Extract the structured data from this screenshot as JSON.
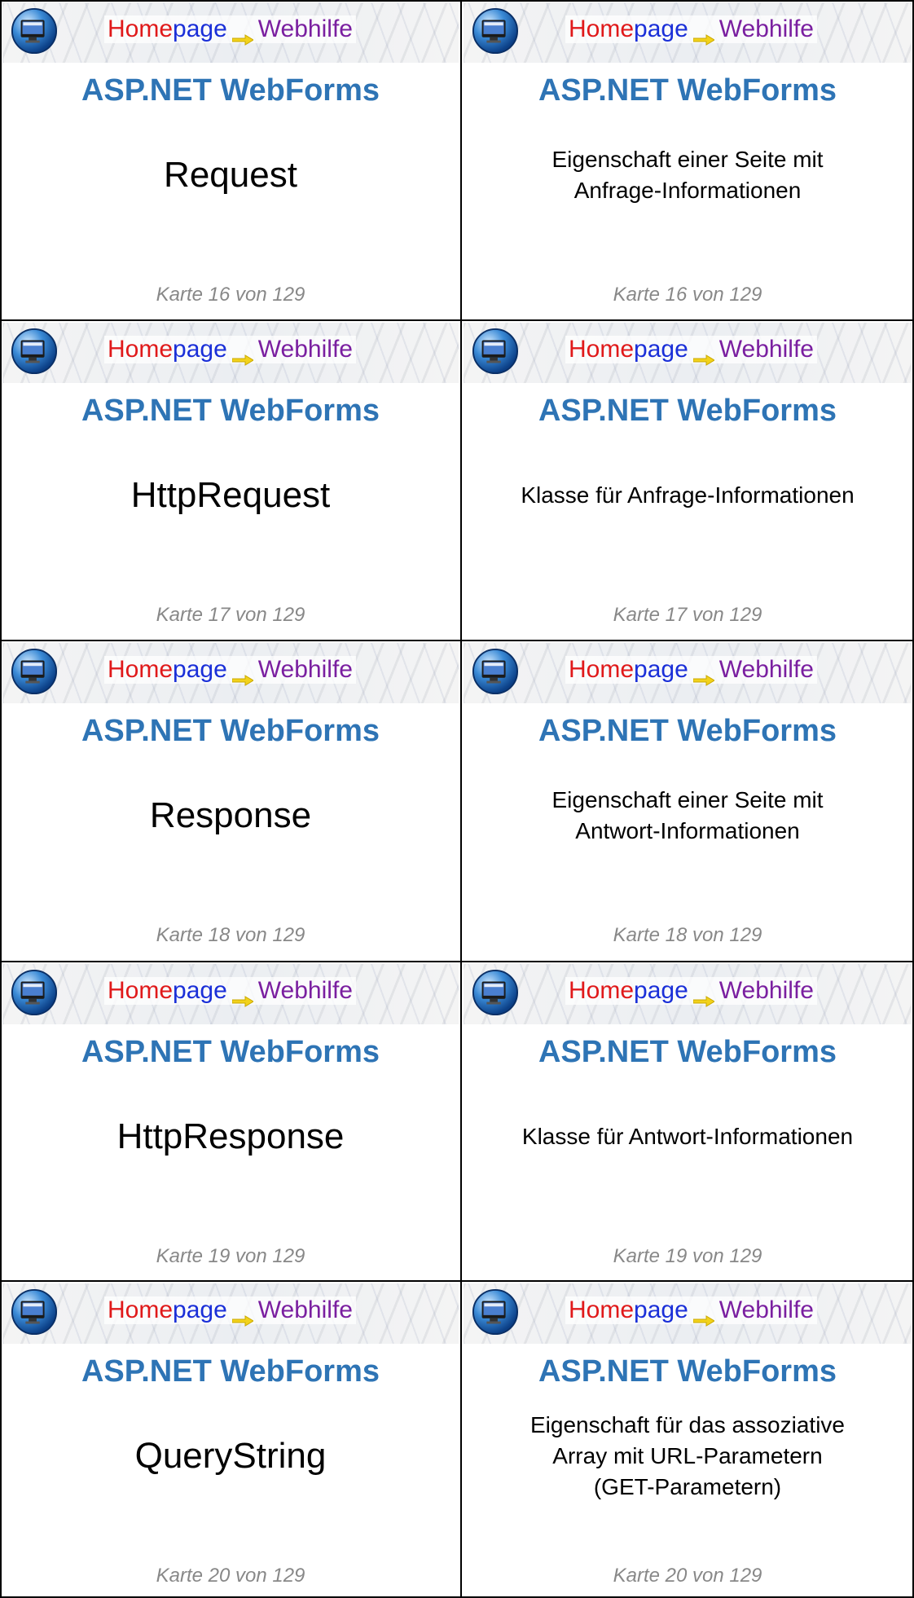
{
  "banner": {
    "home": "Home",
    "page": "page",
    "web": "Webhilfe",
    "globe_icon": "globe-monitor-icon",
    "arrow_icon": "yellow-arrow-icon"
  },
  "cards": [
    {
      "title": "ASP.NET WebForms",
      "term": "Request",
      "definition": "Eigenschaft einer Seite mit\nAnfrage-Informationen",
      "footer": "Karte 16 von 129"
    },
    {
      "title": "ASP.NET WebForms",
      "term": "HttpRequest",
      "definition": "Klasse für Anfrage-Informationen",
      "footer": "Karte 17 von 129"
    },
    {
      "title": "ASP.NET WebForms",
      "term": "Response",
      "definition": "Eigenschaft einer Seite mit\nAntwort-Informationen",
      "footer": "Karte 18 von 129"
    },
    {
      "title": "ASP.NET WebForms",
      "term": "HttpResponse",
      "definition": "Klasse für Antwort-Informationen",
      "footer": "Karte 19 von 129"
    },
    {
      "title": "ASP.NET WebForms",
      "term": "QueryString",
      "definition": "Eigenschaft für das assoziative\nArray mit URL-Parametern\n(GET-Parametern)",
      "footer": "Karte 20 von 129"
    }
  ]
}
